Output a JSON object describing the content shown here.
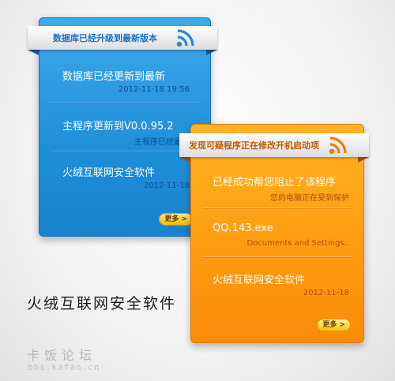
{
  "colors": {
    "blue_accent": "#1f8fd9",
    "orange_accent": "#ff9a10",
    "rss_orange": "#f07c00"
  },
  "blue_panel": {
    "header": "数据库已经升级到最新版本",
    "header_icon": "rss-icon",
    "items": [
      {
        "title": "数据库已经更新到最新",
        "sub": "2012-11-18 19:56"
      },
      {
        "title": "主程序更新到V0.0.95.2",
        "sub": "主程序已经最新"
      },
      {
        "title": "火绒互联网安全软件",
        "sub": "2012-11-18"
      }
    ],
    "more_label": "更多 >"
  },
  "orange_panel": {
    "header": "发现可疑程序正在修改开机启动项",
    "header_icon": "rss-icon",
    "items": [
      {
        "title": "已经成功帮您阻止了该程序",
        "sub": "您的电脑正在受到保护"
      },
      {
        "title": "QQ.143.exe",
        "sub": "Documents and Settings.."
      },
      {
        "title": "火绒互联网安全软件",
        "sub": "2012-11-18"
      }
    ],
    "more_label": "更多 >"
  },
  "caption": "火绒互联网安全软件",
  "watermark": {
    "name": "卡饭论坛",
    "url": "bbs.kafan.cn"
  }
}
